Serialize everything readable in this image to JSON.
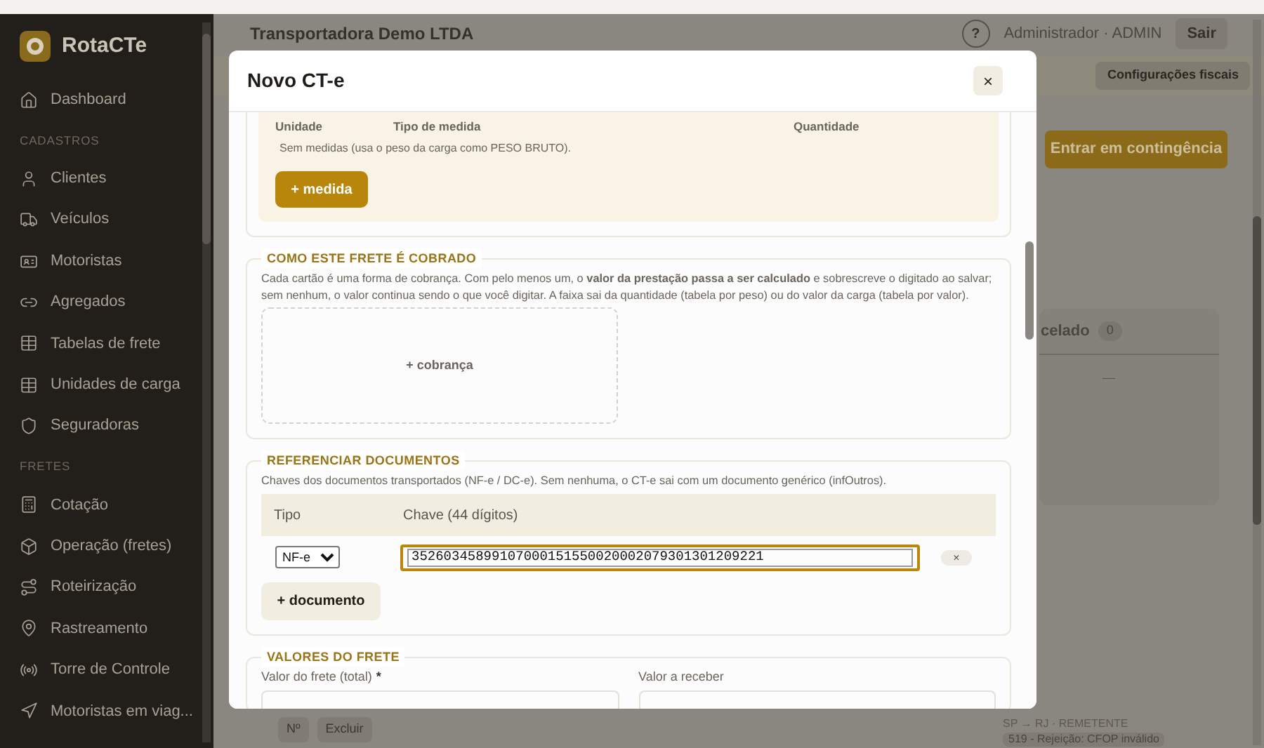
{
  "sidebar": {
    "brand": "RotaCTe",
    "groups": [
      {
        "items": [
          {
            "label": "Dashboard"
          }
        ]
      },
      {
        "heading": "CADASTROS",
        "items": [
          {
            "label": "Clientes"
          },
          {
            "label": "Veículos"
          },
          {
            "label": "Motoristas"
          },
          {
            "label": "Agregados"
          },
          {
            "label": "Tabelas de frete"
          },
          {
            "label": "Unidades de carga"
          },
          {
            "label": "Seguradoras"
          }
        ]
      },
      {
        "heading": "FRETES",
        "items": [
          {
            "label": "Cotação"
          },
          {
            "label": "Operação (fretes)"
          },
          {
            "label": "Roteirização"
          },
          {
            "label": "Rastreamento"
          },
          {
            "label": "Torre de Controle"
          },
          {
            "label": "Motoristas em viag..."
          }
        ]
      }
    ]
  },
  "header": {
    "company": "Transportadora Demo LTDA",
    "help": "?",
    "user": "Administrador · ADMIN",
    "logout": "Sair"
  },
  "banner": {
    "button": "Configurações fiscais"
  },
  "contingency_button": "Entrar em contingência",
  "status_card": {
    "title": "celado",
    "count": "0",
    "value": "—"
  },
  "bottom": {
    "buttons": [
      "Nº",
      "Excluir"
    ],
    "route": "SP → RJ · REMETENTE",
    "rejection": "519 - Rejeição: CFOP inválido"
  },
  "modal": {
    "title": "Novo CT-e",
    "close": "×",
    "measures": {
      "columns": [
        "Unidade",
        "Tipo de medida",
        "Quantidade"
      ],
      "empty": "Sem medidas (usa o peso da carga como PESO BRUTO).",
      "add": "+ medida"
    },
    "charging": {
      "legend": "COMO ESTE FRETE É COBRADO",
      "text": "Cada cartão é uma forma de cobrança. Com pelo menos um, o **valor da prestação passa a ser calculado** e sobrescreve o digitado ao salvar; sem nenhum, o valor continua sendo o que você digitar. A faixa sai da quantidade (tabela por peso) ou do valor da carga (tabela por valor).",
      "add": "+ cobrança"
    },
    "documents": {
      "legend": "REFERENCIAR DOCUMENTOS",
      "text": "Chaves dos documentos transportados (NF-e / DC-e). Sem nenhuma, o CT-e sai com um documento genérico (infOutros).",
      "columns": [
        "Tipo",
        "Chave (44 dígitos)"
      ],
      "rows": [
        {
          "type": "NF-e",
          "key": "35260345899107000151550020002079301301209221",
          "remove": "×"
        }
      ],
      "add": "+ documento"
    },
    "values": {
      "legend": "VALORES DO FRETE",
      "fields": [
        {
          "label": "Valor do frete (total)",
          "required_mark": "*"
        },
        {
          "label": "Valor a receber"
        }
      ]
    }
  }
}
